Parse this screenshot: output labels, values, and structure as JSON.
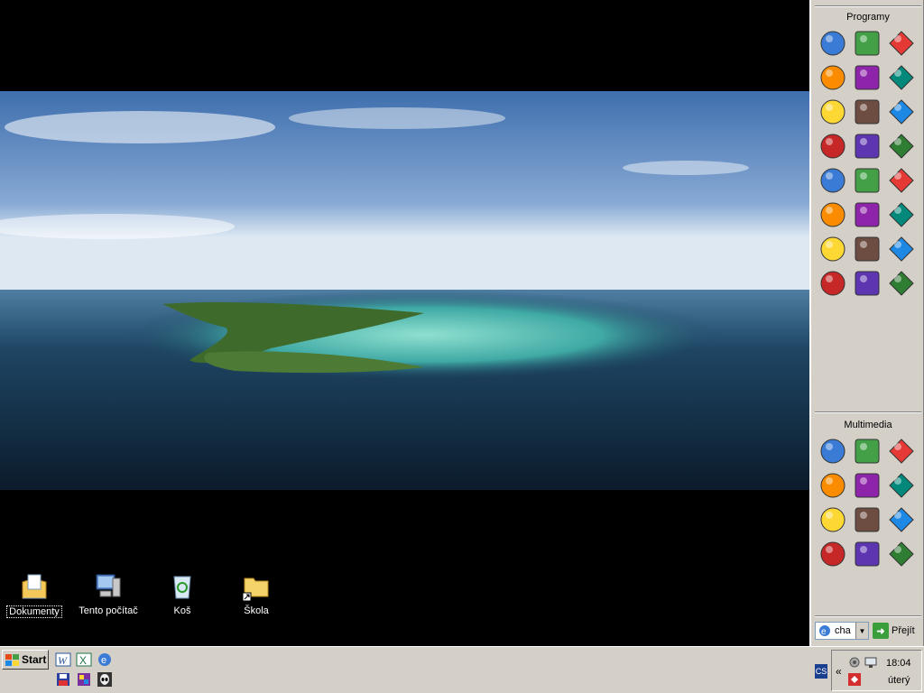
{
  "desktop": {
    "icons": [
      {
        "label": "Dokumenty",
        "icon": "my-documents-icon",
        "selected": true
      },
      {
        "label": "Tento počítač",
        "icon": "my-computer-icon",
        "selected": false
      },
      {
        "label": "Koš",
        "icon": "recycle-bin-icon",
        "selected": false
      },
      {
        "label": "Škola",
        "icon": "folder-shortcut-icon",
        "selected": false
      }
    ]
  },
  "side_panel": {
    "programs_title": "Programy",
    "programs": [
      "internet-explorer-icon",
      "ie-green-e-icon",
      "acrobat-reader-icon",
      "winamp-bolt-icon",
      "system-tool-icon",
      "dreamweaver-icon",
      "fireworks-icon",
      "burning-disc-icon",
      "tools-icon",
      "recycle-bin-icon",
      "lexicon-icon",
      "dosbox-icon",
      "window-manager-icon",
      "racing-game-icon",
      "cd-logo-icon",
      "notepad-info-icon",
      "cd-disc-icon",
      "firefox-icon",
      "opera-icon",
      "globe-icon",
      "paint-icon",
      "calculator-app-icon",
      "game-creature-icon",
      "half-life-icon"
    ],
    "multimedia_title": "Multimedia",
    "multimedia": [
      "feather-icon",
      "dancer-icon",
      "red-arrow-icon",
      "sync-arrows-icon",
      "orange-diamond-icon",
      "alien-mask-icon",
      "red-splat-icon",
      "photo-album-icon",
      "blue-crab-icon",
      "purple-circle-icon",
      "flask-icon",
      "lifebuoy-icon"
    ],
    "address": {
      "value": "cha",
      "go_label": "Přejít"
    }
  },
  "taskbar": {
    "start_label": "Start",
    "quick_launch": [
      "word-icon",
      "excel-icon",
      "internet-explorer-icon",
      "save-disk-icon",
      "paint-icon",
      "alien-mask-icon"
    ],
    "language": "CS",
    "tray_chevron": "«",
    "clock": "18:04",
    "day": "úterý"
  },
  "colors": {
    "panel_bg": "#d4d0c8",
    "desktop_bg": "#000000",
    "sea": "#1d3a55",
    "sky": "#4b7bb7"
  }
}
